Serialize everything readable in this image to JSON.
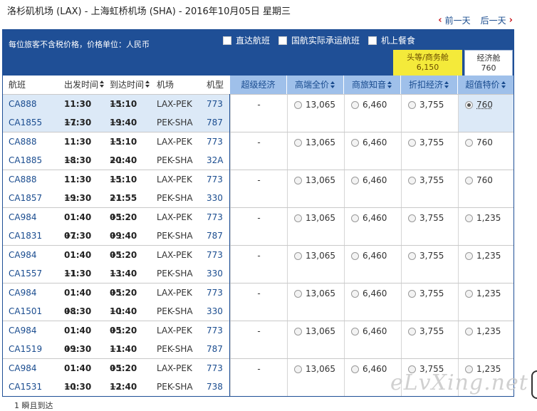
{
  "header": {
    "title": "洛杉矶机场 (LAX) - 上海虹桥机场 (SHA) - 2016年10月05日 星期三",
    "prev_day": "前一天",
    "next_day": "后一天"
  },
  "bar": {
    "note": "每位旅客不含税价格，价格单位：人民币",
    "options": [
      "直达航班",
      "国航实际承运航班",
      "机上餐食"
    ]
  },
  "cabin_tabs": [
    {
      "label": "头等/商务舱",
      "price": "6,150"
    },
    {
      "label": "经济舱",
      "price": "760"
    }
  ],
  "columns": {
    "left": [
      "航班",
      "出发时间",
      "到达时间",
      "机场",
      "机型"
    ],
    "fares": [
      "超级经济",
      "高端全价",
      "商旅知音",
      "折扣经济",
      "超值特价"
    ]
  },
  "itineraries": [
    {
      "selected": true,
      "legs": [
        {
          "flight": "CA888",
          "dep": "11:30",
          "arr": "15:10",
          "arr_plus": "+1",
          "route": "LAX-PEK",
          "aircraft": "773"
        },
        {
          "flight": "CA1855",
          "dep": "17:30",
          "dep_plus": "+1",
          "arr": "19:40",
          "arr_plus": "+1",
          "route": "PEK-SHA",
          "aircraft": "787"
        }
      ],
      "fares": [
        "-",
        "13,065",
        "6,460",
        "3,755",
        "760"
      ]
    },
    {
      "selected": false,
      "legs": [
        {
          "flight": "CA888",
          "dep": "11:30",
          "arr": "15:10",
          "arr_plus": "+1",
          "route": "LAX-PEK",
          "aircraft": "773"
        },
        {
          "flight": "CA1885",
          "dep": "18:30",
          "dep_plus": "+1",
          "arr": "20:40",
          "arr_plus": "+1",
          "route": "PEK-SHA",
          "aircraft": "32A"
        }
      ],
      "fares": [
        "-",
        "13,065",
        "6,460",
        "3,755",
        "760"
      ]
    },
    {
      "selected": false,
      "legs": [
        {
          "flight": "CA888",
          "dep": "11:30",
          "arr": "15:10",
          "arr_plus": "+1",
          "route": "LAX-PEK",
          "aircraft": "773"
        },
        {
          "flight": "CA1857",
          "dep": "19:30",
          "dep_plus": "+1",
          "arr": "21:55",
          "arr_plus": "+1",
          "route": "PEK-SHA",
          "aircraft": "330"
        }
      ],
      "fares": [
        "-",
        "13,065",
        "6,460",
        "3,755",
        "760"
      ]
    },
    {
      "selected": false,
      "legs": [
        {
          "flight": "CA984",
          "dep": "01:40",
          "arr": "05:20",
          "arr_plus": "+1",
          "route": "LAX-PEK",
          "aircraft": "773"
        },
        {
          "flight": "CA1831",
          "dep": "07:30",
          "dep_plus": "+1",
          "arr": "09:40",
          "arr_plus": "+1",
          "route": "PEK-SHA",
          "aircraft": "787"
        }
      ],
      "fares": [
        "-",
        "13,065",
        "6,460",
        "3,755",
        "1,235"
      ]
    },
    {
      "selected": false,
      "legs": [
        {
          "flight": "CA984",
          "dep": "01:40",
          "arr": "05:20",
          "arr_plus": "+1",
          "route": "LAX-PEK",
          "aircraft": "773"
        },
        {
          "flight": "CA1557",
          "dep": "11:30",
          "dep_plus": "+1",
          "arr": "13:40",
          "arr_plus": "+1",
          "route": "PEK-SHA",
          "aircraft": "330"
        }
      ],
      "fares": [
        "-",
        "13,065",
        "6,460",
        "3,755",
        "1,235"
      ]
    },
    {
      "selected": false,
      "legs": [
        {
          "flight": "CA984",
          "dep": "01:40",
          "arr": "05:20",
          "arr_plus": "+1",
          "route": "LAX-PEK",
          "aircraft": "773"
        },
        {
          "flight": "CA1501",
          "dep": "08:30",
          "dep_plus": "+1",
          "arr": "10:40",
          "arr_plus": "+1",
          "route": "PEK-SHA",
          "aircraft": "330"
        }
      ],
      "fares": [
        "-",
        "13,065",
        "6,460",
        "3,755",
        "1,235"
      ]
    },
    {
      "selected": false,
      "legs": [
        {
          "flight": "CA984",
          "dep": "01:40",
          "arr": "05:20",
          "arr_plus": "+1",
          "route": "LAX-PEK",
          "aircraft": "773"
        },
        {
          "flight": "CA1519",
          "dep": "09:30",
          "dep_plus": "+1",
          "arr": "11:40",
          "arr_plus": "+1",
          "route": "PEK-SHA",
          "aircraft": "787"
        }
      ],
      "fares": [
        "-",
        "13,065",
        "6,460",
        "3,755",
        "1,235"
      ]
    },
    {
      "selected": false,
      "legs": [
        {
          "flight": "CA984",
          "dep": "01:40",
          "arr": "05:20",
          "arr_plus": "+1",
          "route": "LAX-PEK",
          "aircraft": "773"
        },
        {
          "flight": "CA1531",
          "dep": "10:30",
          "dep_plus": "+1",
          "arr": "12:40",
          "arr_plus": "+1",
          "route": "PEK-SHA",
          "aircraft": "738"
        }
      ],
      "fares": [
        "-",
        "13,065",
        "6,460",
        "3,755",
        "1,235"
      ]
    }
  ],
  "watermark": "eLvXing.net",
  "footer": "1 瞬且到达"
}
